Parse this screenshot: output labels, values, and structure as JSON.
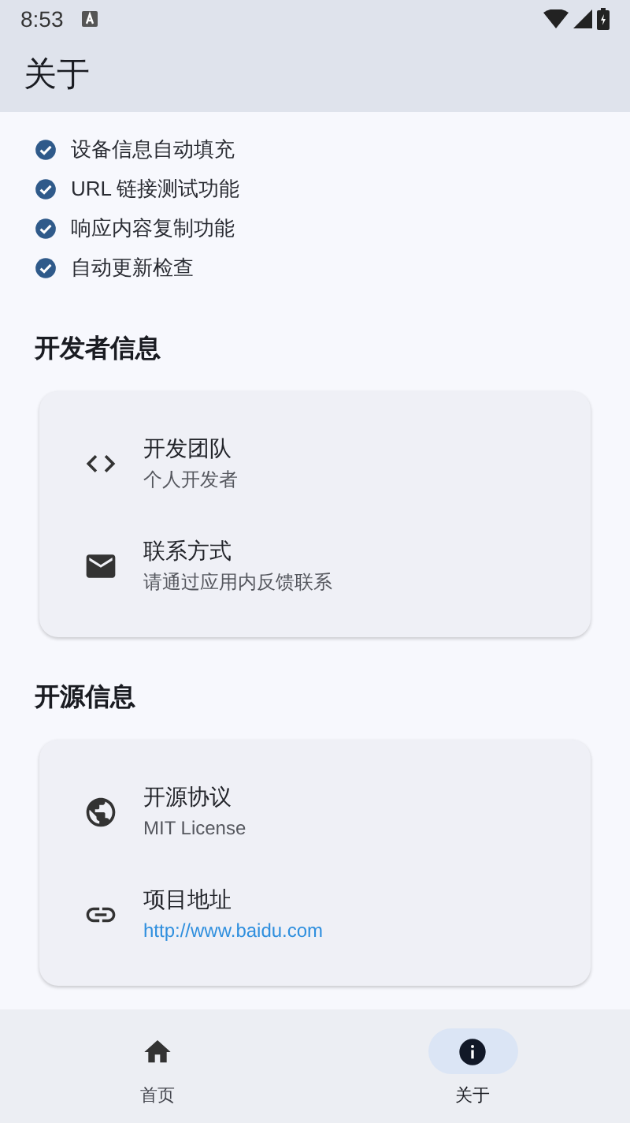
{
  "status_bar": {
    "time": "8:53"
  },
  "app_bar": {
    "title": "关于"
  },
  "features": [
    {
      "label": "设备信息自动填充",
      "checked": true
    },
    {
      "label": "URL 链接测试功能",
      "checked": true
    },
    {
      "label": "响应内容复制功能",
      "checked": true
    },
    {
      "label": "自动更新检查",
      "checked": true
    }
  ],
  "sections": [
    {
      "title": "开发者信息",
      "items": [
        {
          "title": "开发团队",
          "subtitle": "个人开发者",
          "kind": "text"
        },
        {
          "title": "联系方式",
          "subtitle": "请通过应用内反馈联系",
          "kind": "text"
        }
      ]
    },
    {
      "title": "开源信息",
      "items": [
        {
          "title": "开源协议",
          "subtitle": "MIT License",
          "kind": "text"
        },
        {
          "title": "项目地址",
          "subtitle": "http://www.baidu.com",
          "kind": "link"
        }
      ]
    }
  ],
  "nav": [
    {
      "label": "首页",
      "selected": false
    },
    {
      "label": "关于",
      "selected": true
    }
  ]
}
